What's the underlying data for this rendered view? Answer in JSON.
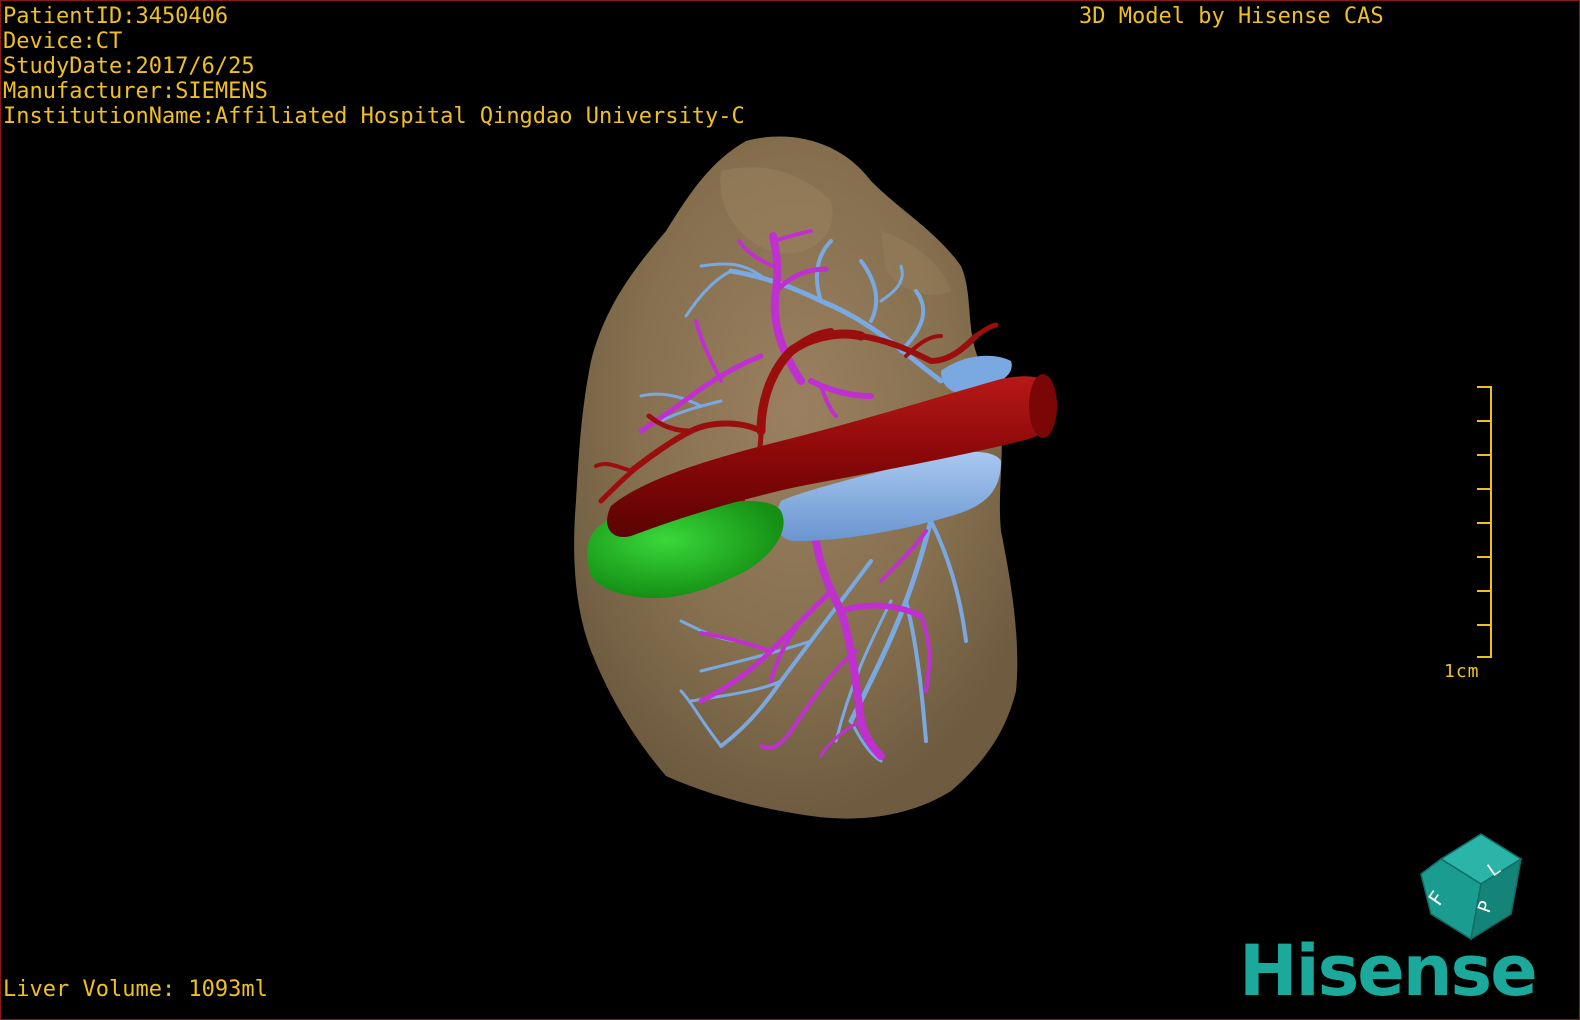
{
  "overlay": {
    "patient_id": "PatientID:3450406",
    "device": "Device:CT",
    "study_date": "StudyDate:2017/6/25",
    "manufacturer": "Manufacturer:SIEMENS",
    "institution": "InstitutionName:Affiliated Hospital Qingdao University-C",
    "model_credit": "3D Model by Hisense CAS",
    "liver_volume": "Liver Volume: 1093ml",
    "scale_label": "1cm"
  },
  "orientation_cube": {
    "labels": [
      "F",
      "L",
      "P"
    ]
  },
  "brand": {
    "logo_text": "Hisense",
    "color": "#1aa99a"
  },
  "colors": {
    "text": "#f0c020",
    "liver": "#8b7355",
    "artery": "#8b0a0a",
    "portal_vein": "#c030d0",
    "hepatic_vein": "#7aa8e0",
    "gallbladder": "#22b022",
    "border": "#8a1a1a"
  }
}
